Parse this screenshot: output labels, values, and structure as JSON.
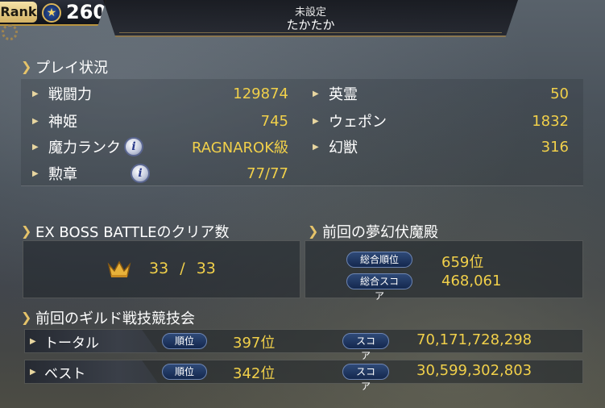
{
  "header": {
    "rank_label": "Rank",
    "rank_value": "260",
    "title": "未設定",
    "player_name": "たかたか"
  },
  "play_status": {
    "heading": "プレイ状況",
    "left": [
      {
        "label": "戦闘力",
        "value": "129874",
        "info": false
      },
      {
        "label": "神姫",
        "value": "745",
        "info": false
      },
      {
        "label": "魔力ランク",
        "value": "RAGNAROK級",
        "info": true
      },
      {
        "label": "勲章",
        "value": "77/77",
        "info": true
      }
    ],
    "right": [
      {
        "label": "英霊",
        "value": "50"
      },
      {
        "label": "ウェポン",
        "value": "1832"
      },
      {
        "label": "幻獣",
        "value": "316"
      }
    ]
  },
  "ex_boss": {
    "heading": "EX BOSS BATTLEのクリア数",
    "cleared": "33",
    "separator": "/",
    "total": "33"
  },
  "dream": {
    "heading": "前回の夢幻伏魔殿",
    "rank_label": "総合順位",
    "rank_value": "659位",
    "score_label": "総合スコア",
    "score_value": "468,061"
  },
  "guild": {
    "heading": "前回のギルド戦技競技会",
    "rows": [
      {
        "label": "トータル",
        "rank_label": "順位",
        "rank_value": "397位",
        "score_label": "スコア",
        "score_value": "70,171,728,298"
      },
      {
        "label": "ベスト",
        "rank_label": "順位",
        "rank_value": "342位",
        "score_label": "スコア",
        "score_value": "30,599,302,803"
      }
    ]
  },
  "icons": {
    "rank_star": "star-icon",
    "info": "info-icon",
    "crown": "crown-icon",
    "section_arrow": "chevron-right-icon",
    "bullet": "triangle-right-icon"
  },
  "colors": {
    "accent_gold": "#f1d04a",
    "pill_blue": "#2f4a78",
    "frame_gold": "#b8933e"
  }
}
